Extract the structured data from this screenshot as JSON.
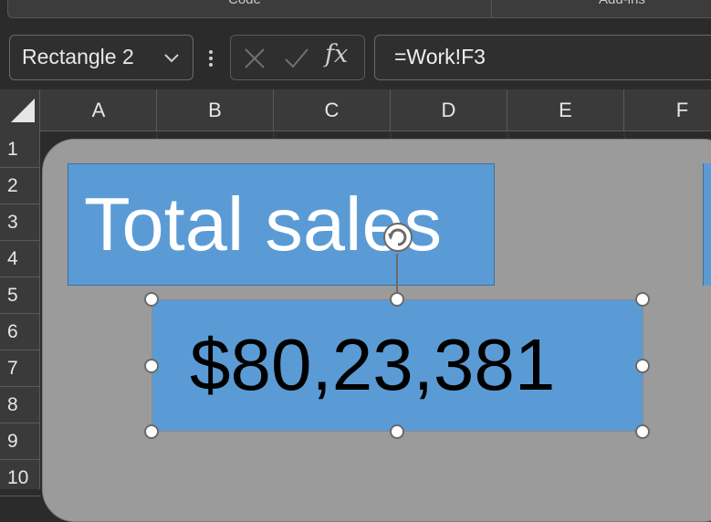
{
  "ribbon": {
    "groups": [
      {
        "label": "Code"
      },
      {
        "label": "Add-ins"
      }
    ]
  },
  "name_box": {
    "value": "Rectangle 2",
    "icon": "chevron-down-icon"
  },
  "formula_bar": {
    "cancel_icon": "x-icon",
    "enter_icon": "check-icon",
    "insert_function_label": "fx",
    "formula": "=Work!F3"
  },
  "grid": {
    "columns": [
      "A",
      "B",
      "C",
      "D",
      "E",
      "F"
    ],
    "rows": [
      "1",
      "2",
      "3",
      "4",
      "5",
      "6",
      "7",
      "8",
      "9",
      "10"
    ]
  },
  "shapes": {
    "title": {
      "text": "Total sales",
      "fill": "#5b9bd5",
      "text_color": "#ffffff"
    },
    "value": {
      "text": "$80,23,381",
      "fill": "#5b9bd5",
      "text_color": "#000000"
    },
    "background_fill": "#9b9b9b"
  }
}
